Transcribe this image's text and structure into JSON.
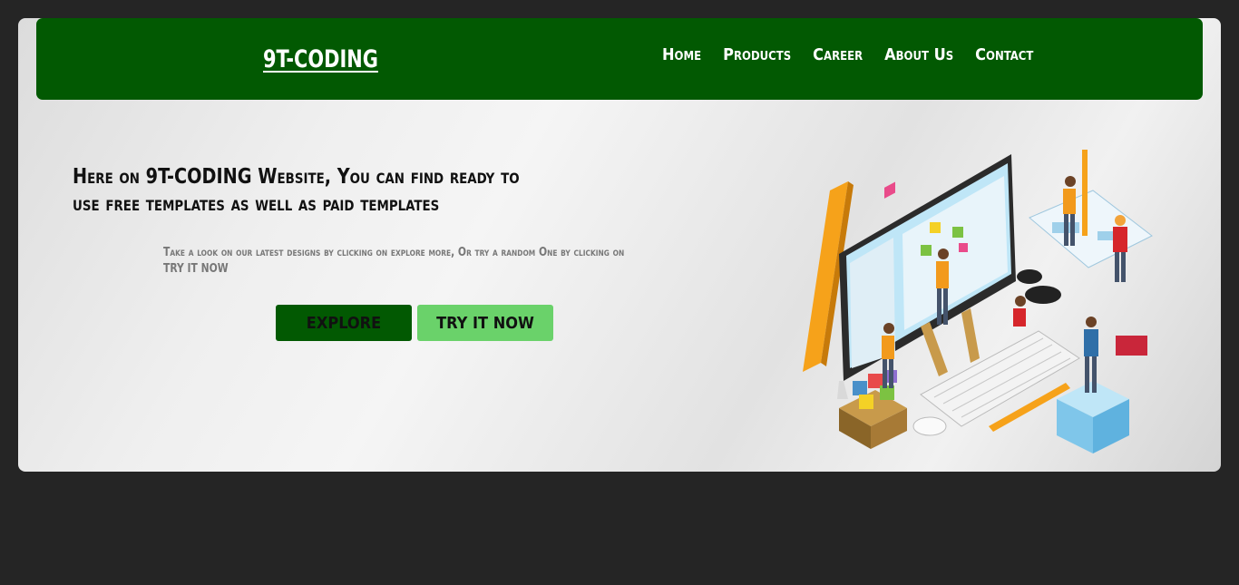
{
  "header": {
    "logo": "9T-CODING",
    "nav": [
      "Home",
      "Products",
      "Career",
      "About Us",
      "Contact"
    ]
  },
  "hero": {
    "headline": "Here on 9T-CODING Website, You can find ready to use free templates as well as paid templates",
    "subtext": "Take a look on our latest designs by clicking on explore more, Or try a random One by clicking on TRY IT NOW",
    "explore_label": "EXPLORE",
    "try_label": "TRY IT NOW"
  },
  "colors": {
    "page_background": "#252525",
    "navbar": "#025902",
    "explore_button": "#025902",
    "try_button": "#6ad26a"
  },
  "illustration": "isometric-developers-illustration"
}
